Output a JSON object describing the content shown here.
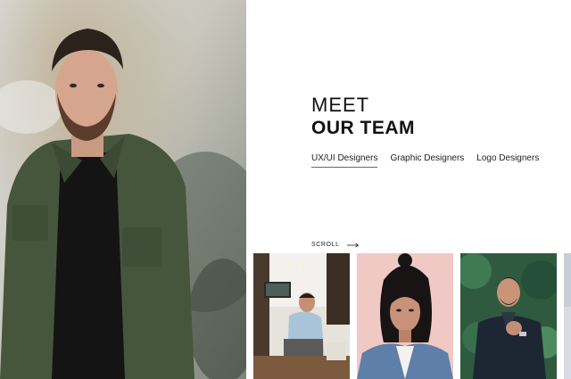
{
  "heading": {
    "line1": "MEET",
    "line2": "OUR TEAM"
  },
  "tabs": [
    {
      "label": "UX/UI Designers",
      "active": true
    },
    {
      "label": "Graphic Designers",
      "active": false
    },
    {
      "label": "Logo Designers",
      "active": false
    }
  ],
  "scroll": {
    "label": "SCROLL",
    "icon": "arrow-right-icon"
  },
  "colors": {
    "text": "#111111",
    "jacket_green": "#47573c",
    "card_pink": "#f1c9c4",
    "card_green": "#2f5a3f"
  }
}
